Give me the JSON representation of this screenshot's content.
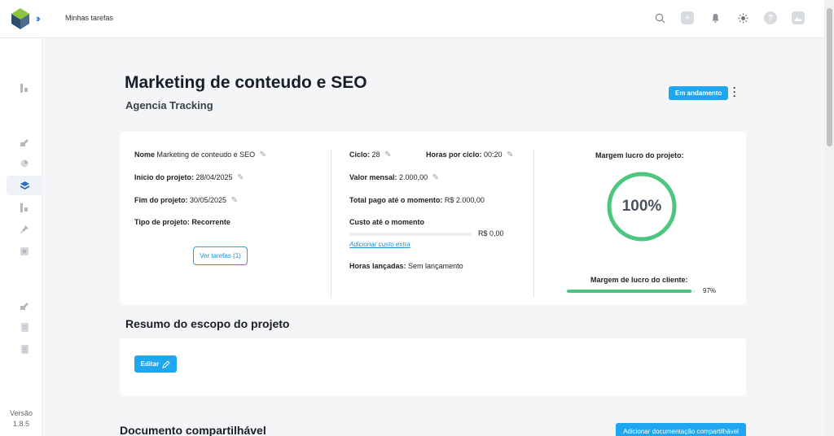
{
  "header": {
    "breadcrumb": "Minhas tarefas"
  },
  "topbar_icons": [
    "search-icon",
    "plus-box-icon",
    "bell-icon",
    "sun-icon",
    "help-icon",
    "image-icon"
  ],
  "sidebar": {
    "items": [
      "dashboard-icon",
      "edit-icon",
      "pie-chart-icon",
      "layers-icon",
      "chart-icon",
      "pin-icon",
      "clock-icon",
      "edit-alt-icon",
      "document-icon",
      "list-icon"
    ],
    "version_label": "Versão",
    "version_number": "1.8.5"
  },
  "project": {
    "title": "Marketing de conteudo e SEO",
    "client": "Agencia Tracking",
    "status": "Em andamento"
  },
  "details": {
    "name_label": "Nome",
    "name_value": "Marketing de conteudo e SEO",
    "start_label": "Início do projeto:",
    "start_value": "28/04/2025",
    "end_label": "Fim do projeto:",
    "end_value": "30/05/2025",
    "type_label": "Tipo de projeto:",
    "type_value": "Recorrente",
    "tasks_button": "Ver tarefas (1)"
  },
  "finance": {
    "cycle_label": "Ciclo:",
    "cycle_value": "28",
    "hours_cycle_label": "Horas por ciclo:",
    "hours_cycle_value": "00:20",
    "monthly_label": "Valor mensal:",
    "monthly_value": "2.000,00",
    "paid_label": "Total pago até o momento:",
    "paid_value": "R$ 2.000,00",
    "cost_label": "Custo até o momento",
    "cost_value": "R$ 0,00",
    "cost_fraction": 0,
    "add_cost_link": "Adicionar custo extra",
    "hours_logged_label": "Horas lançadas:",
    "hours_logged_value": "Sem lançamento"
  },
  "margins": {
    "project_title": "Margem lucro do projeto:",
    "project_value": "100%",
    "project_fraction": 1.0,
    "client_title": "Margem de lucro do cliente:",
    "client_value": "97%",
    "client_fraction": 0.97,
    "color": "#4cc57f"
  },
  "scope": {
    "title": "Resumo do escopo do projeto",
    "edit_button": "Editar"
  },
  "documents": {
    "title": "Documento compartilhável",
    "add_button": "Adicionar documentação compartilhável"
  },
  "colors": {
    "accent": "#1ea7f0",
    "success": "#4cc57f"
  }
}
